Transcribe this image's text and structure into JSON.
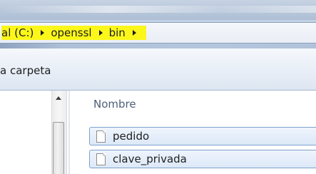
{
  "address_bar": {
    "breadcrumbs": [
      {
        "label": "al (C:)"
      },
      {
        "label": "openssl"
      },
      {
        "label": "bin"
      }
    ]
  },
  "command_bar": {
    "new_folder_label": "a carpeta"
  },
  "file_list": {
    "column_header": "Nombre",
    "items": [
      {
        "name": "pedido",
        "icon": "file-icon"
      },
      {
        "name": "clave_privada",
        "icon": "file-icon"
      }
    ]
  },
  "colors": {
    "highlight": "#fbf71a",
    "selection_border": "#7da2ce",
    "selection_fill": "#dde9f8"
  }
}
